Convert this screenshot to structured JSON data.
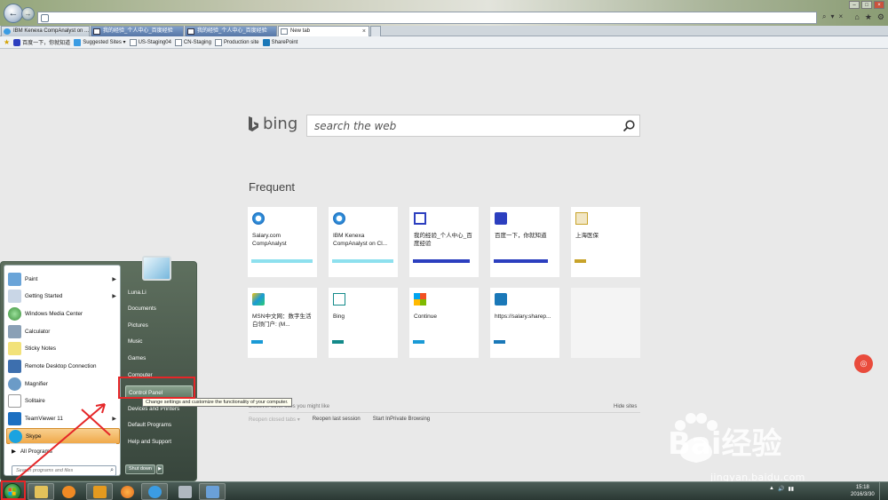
{
  "browser": {
    "address_value": "",
    "tabs": [
      {
        "label": "IBM Kenexa CompAnalyst on ...",
        "style": "normal"
      },
      {
        "label": "我的经验_个人中心_百度经验",
        "style": "blue"
      },
      {
        "label": "我的经验_个人中心_百度经验",
        "style": "blue"
      },
      {
        "label": "New tab",
        "style": "active"
      }
    ],
    "tab_close_glyph": "×",
    "favorites": [
      {
        "label": "百度一下，你就知道"
      },
      {
        "label": "Suggested Sites ▾"
      },
      {
        "label": "US-Staging04"
      },
      {
        "label": "CN-Staging"
      },
      {
        "label": "Production site"
      },
      {
        "label": "SharePoint"
      }
    ]
  },
  "bing": {
    "logo_text": "bing",
    "search_placeholder": "search the web"
  },
  "frequent": {
    "title": "Frequent",
    "tiles": [
      {
        "label": "Salary.com CompAnalyst",
        "icon": "ie-icon",
        "bar_color": "#8ee0ee"
      },
      {
        "label": "IBM Kenexa CompAnalyst on Cl...",
        "icon": "ie-icon",
        "bar_color": "#8ee0ee"
      },
      {
        "label": "我的经验_个人中心_百度经验",
        "icon": "baidu-jingyan-icon",
        "bar_color": "#2c3fbf"
      },
      {
        "label": "百度一下，你就知道",
        "icon": "baidu-paw-icon",
        "bar_color": "#2c3fbf"
      },
      {
        "label": "上海医保",
        "icon": "shanghai-icon",
        "bar_color": "#c8a32a"
      },
      {
        "label": "MSN中文网：数字生活 白领门户: (M...",
        "icon": "msn-icon",
        "bar_color": "#1a9ad6"
      },
      {
        "label": "Bing",
        "icon": "bing-icon",
        "bar_color": "#138a8a"
      },
      {
        "label": "Continue",
        "icon": "windows-icon",
        "bar_color": "#1a9ad6"
      },
      {
        "label": "https://salary.sharep...",
        "icon": "sharepoint-icon",
        "bar_color": "#1a78b8"
      }
    ],
    "discover": "Discover other sites you might like",
    "hide_sites": "Hide sites",
    "reopen_closed": "Reopen closed tabs ▾",
    "reopen_last": "Reopen last session",
    "inprivate": "Start InPrivate Browsing"
  },
  "start_menu": {
    "programs": [
      {
        "label": "Paint",
        "has_arrow": true,
        "icon_color": "#6aa4d8"
      },
      {
        "label": "Getting Started",
        "has_arrow": true,
        "icon_color": "#c9d6e6"
      },
      {
        "label": "Windows Media Center",
        "has_arrow": false,
        "icon_color": "#3a8e3a"
      },
      {
        "label": "Calculator",
        "has_arrow": false,
        "icon_color": "#8aa0b6"
      },
      {
        "label": "Sticky Notes",
        "has_arrow": false,
        "icon_color": "#f2e27a"
      },
      {
        "label": "Remote Desktop Connection",
        "has_arrow": false,
        "icon_color": "#3d6fae"
      },
      {
        "label": "Magnifier",
        "has_arrow": false,
        "icon_color": "#6b9bc7"
      },
      {
        "label": "Solitaire",
        "has_arrow": false,
        "icon_color": "#d9d9d9"
      },
      {
        "label": "TeamViewer 11",
        "has_arrow": true,
        "icon_color": "#1b6fc1"
      },
      {
        "label": "Skype",
        "has_arrow": false,
        "icon_color": "#1aa3e0"
      }
    ],
    "arrow_glyph": "▶",
    "all_programs": "All Programs",
    "search_placeholder": "Search programs and files",
    "places": [
      {
        "label": "Luna.Li"
      },
      {
        "label": "Documents"
      },
      {
        "label": "Pictures"
      },
      {
        "label": "Music"
      },
      {
        "label": "Games"
      },
      {
        "label": "Computer"
      },
      {
        "label": "Control Panel"
      },
      {
        "label": "Devices and Printers"
      },
      {
        "label": "Default Programs"
      },
      {
        "label": "Help and Support"
      }
    ],
    "shutdown": "Shut down",
    "tooltip": "Change settings and customize the functionality of your computer."
  },
  "taskbar": {
    "apps": [
      {
        "name": "explorer-icon",
        "color": "#e3c25a"
      },
      {
        "name": "media-player-icon",
        "color": "#f08a24"
      },
      {
        "name": "outlook-icon",
        "color": "#e59a1f"
      },
      {
        "name": "firefox-icon",
        "color": "#e06a1e"
      },
      {
        "name": "ie-icon",
        "color": "#3b9ce3"
      },
      {
        "name": "network-icon",
        "color": "#b0b8c0"
      },
      {
        "name": "remote-icon",
        "color": "#6aa0d8"
      }
    ],
    "tray_icons": [
      "▲",
      "🔊",
      "▮▮"
    ],
    "time": "15:18",
    "date": "2016/3/30"
  },
  "watermark": {
    "brand": "Bai经验",
    "url": "jingyan.baidu.com"
  },
  "colors": {
    "highlight": "#e52628",
    "bing_blue": "#00809d"
  }
}
